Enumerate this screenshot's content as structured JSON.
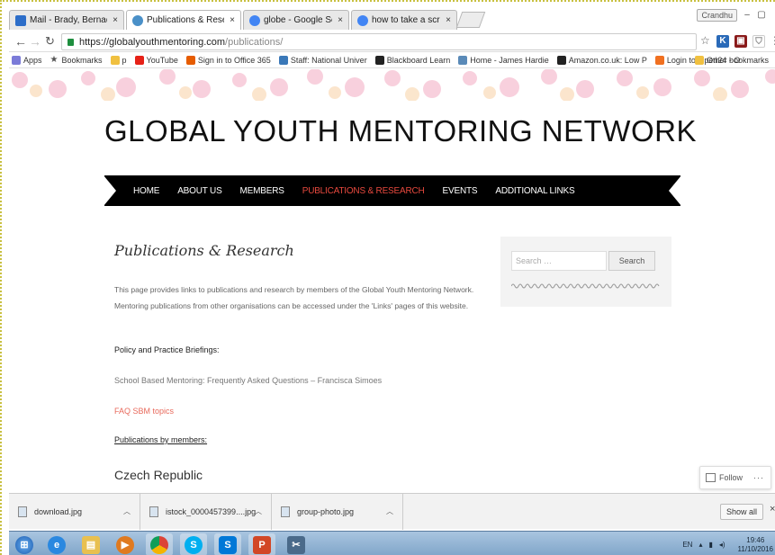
{
  "browser": {
    "tabs": [
      {
        "label": "Mail - Brady, Bernadine",
        "icon": "mail-icon",
        "color": "#2d6ec9",
        "active": false
      },
      {
        "label": "Publications & Research",
        "icon": "site-icon",
        "color": "#4a90c8",
        "active": true
      },
      {
        "label": "globe - Google Search",
        "icon": "google-icon",
        "color": "#4285f4",
        "active": false
      },
      {
        "label": "how to take a screenshot",
        "icon": "google-icon",
        "color": "#4285f4",
        "active": false
      }
    ],
    "profile_label": "Crandhu",
    "url_host": "https://globalyouthmentoring.com",
    "url_path": "/publications/",
    "bookmarks": [
      {
        "label": "Apps",
        "icon": "apps-icon",
        "color": "#7b7bd8"
      },
      {
        "label": "Bookmarks",
        "icon": "star-icon",
        "color": "#555555"
      },
      {
        "label": "p",
        "icon": "folder-icon",
        "color": "#f0c040"
      },
      {
        "label": "YouTube",
        "icon": "youtube-icon",
        "color": "#e62117"
      },
      {
        "label": "Sign in to Office 365",
        "icon": "office-icon",
        "color": "#e65c00"
      },
      {
        "label": "Staff: National Univer",
        "icon": "university-icon",
        "color": "#3a78b8"
      },
      {
        "label": "Blackboard Learn",
        "icon": "blackboard-icon",
        "color": "#222222"
      },
      {
        "label": "Home - James Hardie",
        "icon": "home-icon",
        "color": "#5a8ab8"
      },
      {
        "label": "Amazon.co.uk: Low P",
        "icon": "amazon-icon",
        "color": "#222222"
      },
      {
        "label": "Login to Open24 - O",
        "icon": "open24-icon",
        "color": "#f07020"
      }
    ],
    "other_bookmarks": "Other bookmarks",
    "more_bookmarks": "»"
  },
  "site": {
    "title": "GLOBAL YOUTH MENTORING NETWORK",
    "nav": [
      "HOME",
      "ABOUT US",
      "MEMBERS",
      "PUBLICATIONS & RESEARCH",
      "EVENTS",
      "ADDITIONAL LINKS"
    ],
    "nav_current_index": 3,
    "accent_color": "#e8493e"
  },
  "main": {
    "heading": "Publications & Research",
    "intro": "This page provides links to publications and research by members of the Global Youth Mentoring Network.  Mentoring publications from other organisations can be accessed under the 'Links' pages of this website.",
    "briefings_heading": "Policy and Practice Briefings:",
    "briefing_item": "School Based Mentoring:  Frequently Asked Questions – Francisca Simoes",
    "faq_link": "FAQ SBM topics",
    "pubs_heading": "Publications by members:",
    "country": "Czech Republic"
  },
  "sidebar": {
    "search_placeholder": "Search …",
    "search_button": "Search"
  },
  "follow": {
    "label": "Follow",
    "more": "···"
  },
  "downloads": {
    "items": [
      {
        "name": "download.jpg"
      },
      {
        "name": "istock_0000457399....jpg"
      },
      {
        "name": "group-photo.jpg"
      }
    ],
    "show_all": "Show all",
    "close": "×"
  },
  "taskbar": {
    "apps": [
      {
        "icon": "start-orb-icon",
        "color": "#2a7ad8",
        "glyph": "⊞"
      },
      {
        "icon": "internet-explorer-icon",
        "color": "#2a88e0",
        "glyph": "e"
      },
      {
        "icon": "file-explorer-icon",
        "color": "#e8c050",
        "glyph": "▤"
      },
      {
        "icon": "media-player-icon",
        "color": "#e07a20",
        "glyph": "▶"
      },
      {
        "icon": "chrome-icon",
        "color": "#db4437",
        "glyph": "◉"
      },
      {
        "icon": "skype-icon",
        "color": "#00aff0",
        "glyph": "S"
      },
      {
        "icon": "skype-business-icon",
        "color": "#0078d7",
        "glyph": "S"
      },
      {
        "icon": "powerpoint-icon",
        "color": "#d24726",
        "glyph": "P"
      },
      {
        "icon": "snipping-tool-icon",
        "color": "#4a6a8a",
        "glyph": "✂"
      }
    ],
    "language": "EN",
    "time": "19:46",
    "date": "11/10/2016"
  }
}
